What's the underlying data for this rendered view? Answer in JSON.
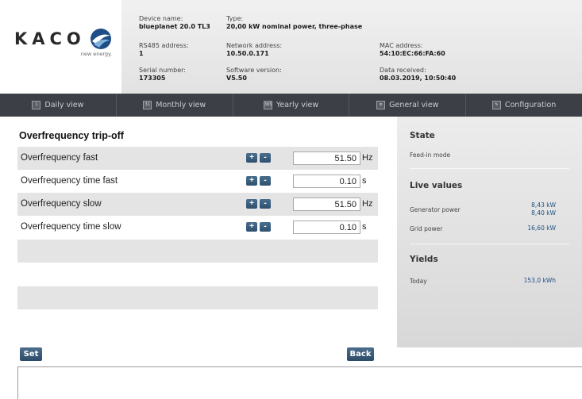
{
  "brand": {
    "logo_text": "KACO",
    "tagline": "new energy."
  },
  "device_info": {
    "device_name": {
      "label": "Device name:",
      "value": "blueplanet 20.0 TL3"
    },
    "type": {
      "label": "Type:",
      "value": "20,00 kW nominal power, three-phase"
    },
    "rs485": {
      "label": "RS485 address:",
      "value": "1"
    },
    "network": {
      "label": "Network address:",
      "value": "10.50.0.171"
    },
    "mac": {
      "label": "MAC address:",
      "value": "54:10:EC:66:FA:60"
    },
    "serial": {
      "label": "Serial number:",
      "value": "173305"
    },
    "software": {
      "label": "Software version:",
      "value": "V5.50"
    },
    "received": {
      "label": "Data received:",
      "value": "08.03.2019, 10:50:40"
    }
  },
  "nav": [
    {
      "label": "Daily view",
      "icon": "1",
      "icon_name": "calendar-day-icon"
    },
    {
      "label": "Monthly view",
      "icon": "31",
      "icon_name": "calendar-month-icon"
    },
    {
      "label": "Yearly view",
      "icon": "365",
      "icon_name": "calendar-year-icon"
    },
    {
      "label": "General view",
      "icon": "≡",
      "icon_name": "overview-icon"
    },
    {
      "label": "Configuration",
      "icon": "✎",
      "icon_name": "wrench-icon"
    }
  ],
  "main": {
    "title": "Overfrequency trip-off",
    "rows": [
      {
        "label": "Overfrequency fast",
        "value": "51.50",
        "unit": "Hz"
      },
      {
        "label": "Overfrequency time fast",
        "value": "0.10",
        "unit": "s"
      },
      {
        "label": "Overfrequency slow",
        "value": "51.50",
        "unit": "Hz"
      },
      {
        "label": "Overfrequency time slow",
        "value": "0.10",
        "unit": "s"
      }
    ],
    "set_label": "Set",
    "back_label": "Back"
  },
  "status": {
    "state_heading": "State",
    "state_value": "Feed-in mode",
    "live_heading": "Live values",
    "generator_label": "Generator power",
    "generator_value_1": "8,43 kW",
    "generator_value_2": "8,40 kW",
    "grid_label": "Grid power",
    "grid_value": "16,60 kW",
    "yields_heading": "Yields",
    "today_label": "Today",
    "today_value": "153,0 kWh"
  },
  "colors": {
    "nav_bg": "#3c4046",
    "button": "#2f506e",
    "value_link": "#1d4f86"
  }
}
